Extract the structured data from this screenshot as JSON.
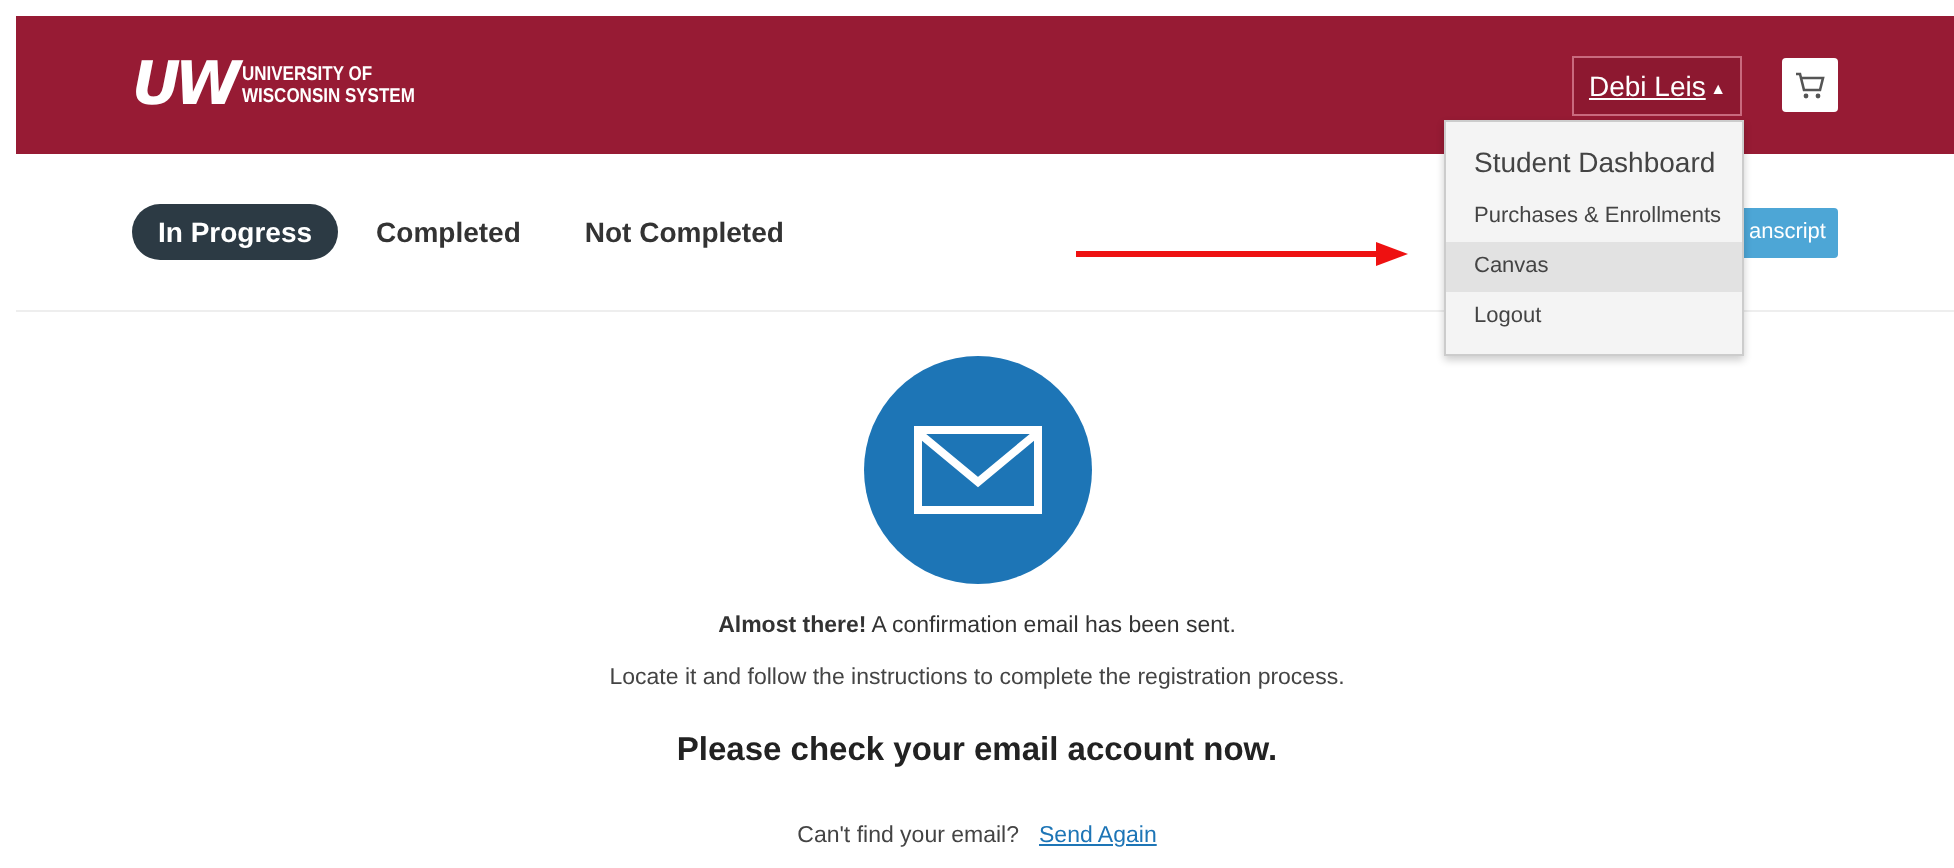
{
  "header": {
    "logo": {
      "mark": "UW",
      "lines": [
        "UNIVERSITY OF",
        "WISCONSIN SYSTEM"
      ]
    },
    "user_menu": {
      "label": "Debi Leis",
      "caret": "▲",
      "expanded": true,
      "items": [
        {
          "label": "Student Dashboard",
          "kind": "heading",
          "selected": false
        },
        {
          "label": "Purchases & Enrollments",
          "kind": "item",
          "selected": false
        },
        {
          "label": "Canvas",
          "kind": "item",
          "selected": true
        },
        {
          "label": "Logout",
          "kind": "item",
          "selected": false
        }
      ]
    }
  },
  "tabs": [
    {
      "label": "In Progress",
      "selected": true
    },
    {
      "label": "Completed",
      "selected": false
    },
    {
      "label": "Not Completed",
      "selected": false
    }
  ],
  "transcript_button": {
    "label": "anscript"
  },
  "message": {
    "lead": "**Almost there!** A confirmation email has been sent.",
    "instruction": "Locate it and follow the instructions to complete the registration process.",
    "headline": "Please check your email account now.",
    "prompt": "Can't find your email?",
    "link": "Send Again"
  }
}
